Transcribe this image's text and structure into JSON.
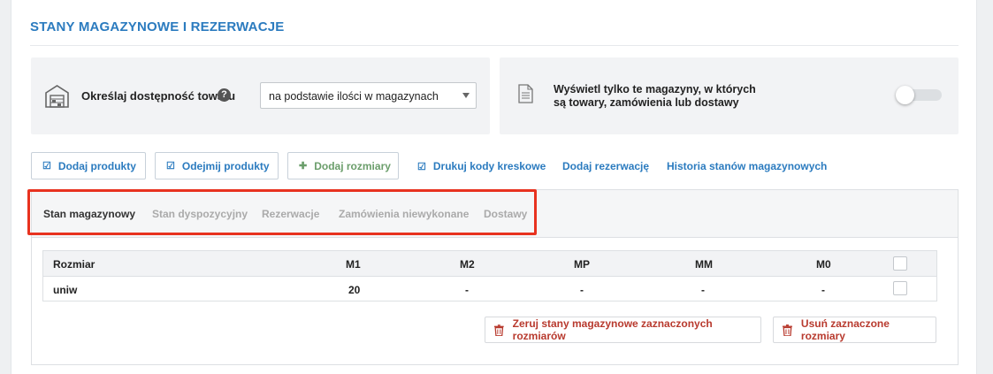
{
  "section": {
    "title": "STANY MAGAZYNOWE I REZERWACJE"
  },
  "availability": {
    "label": "Określaj dostępność towaru",
    "help": "?",
    "selected": "na podstawie ilości w magazynach"
  },
  "filter": {
    "label_line1": "Wyświetl tylko te magazyny, w których",
    "label_line2": "są towary, zamówienia lub dostawy",
    "toggle_on": false
  },
  "actions": {
    "add_products": "Dodaj produkty",
    "subtract_products": "Odejmij produkty",
    "add_sizes": "Dodaj rozmiary",
    "print_barcodes": "Drukuj kody kreskowe",
    "add_reservation": "Dodaj rezerwację",
    "history": "Historia stanów magazynowych"
  },
  "tabs": [
    {
      "label": "Stan magazynowy",
      "active": true
    },
    {
      "label": "Stan dyspozycyjny",
      "active": false
    },
    {
      "label": "Rezerwacje",
      "active": false
    },
    {
      "label": "Zamówienia niewykonane",
      "active": false
    },
    {
      "label": "Dostawy",
      "active": false
    }
  ],
  "table": {
    "headers": [
      "Rozmiar",
      "M1",
      "M2",
      "MP",
      "MM",
      "M0"
    ],
    "rows": [
      {
        "size": "uniw",
        "values": [
          "20",
          "-",
          "-",
          "-",
          "-"
        ]
      }
    ]
  },
  "bulk": {
    "zero_stock": "Zeruj stany magazynowe zaznaczonych rozmiarów",
    "remove_sizes": "Usuń zaznaczone rozmiary"
  },
  "colors": {
    "accent": "#2b7bbf",
    "danger": "#b83a2e",
    "highlight": "#e8321f",
    "green": "#6b9e6b"
  },
  "icons": {
    "warehouse": "warehouse-icon",
    "document": "document-icon",
    "edit": "edit-icon",
    "plus": "plus-icon",
    "trash": "trash-icon"
  }
}
